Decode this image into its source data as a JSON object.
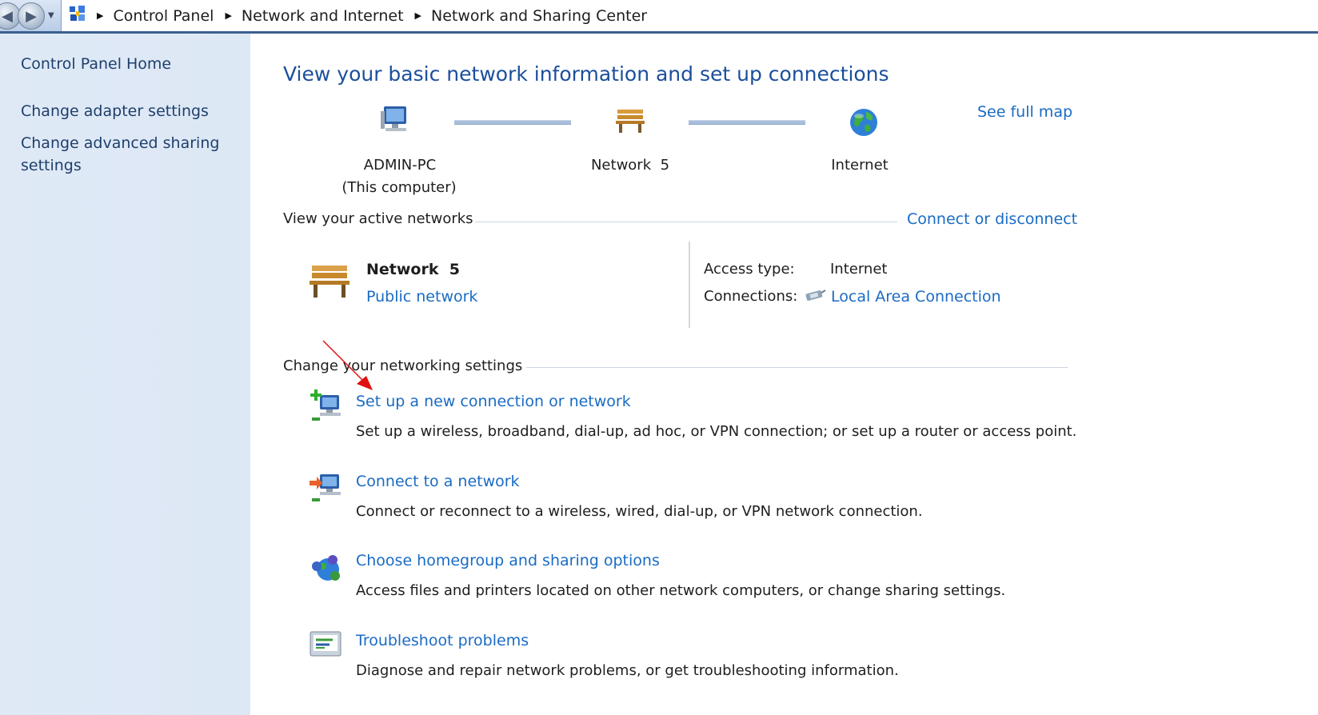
{
  "breadcrumb": {
    "items": [
      "Control Panel",
      "Network and Internet",
      "Network and Sharing Center"
    ]
  },
  "sidebar": {
    "home": "Control Panel Home",
    "links": [
      "Change adapter settings",
      "Change advanced sharing",
      "settings"
    ]
  },
  "main": {
    "title": "View your basic network information and set up connections",
    "see_full_map": "See full map",
    "map": {
      "computer_name": "ADMIN-PC",
      "computer_sub": "(This computer)",
      "network_name": "Network  5",
      "internet": "Internet"
    },
    "active": {
      "heading": "View your active networks",
      "connect_link": "Connect or disconnect",
      "network_name": "Network  5",
      "network_type": "Public network",
      "access_label": "Access type:",
      "access_value": "Internet",
      "connections_label": "Connections:",
      "connections_value": "Local Area Connection"
    },
    "change": {
      "heading": "Change your networking settings",
      "tasks": [
        {
          "title": "Set up a new connection or network",
          "desc": "Set up a wireless, broadband, dial-up, ad hoc, or VPN connection; or set up a router or access point."
        },
        {
          "title": "Connect to a network",
          "desc": "Connect or reconnect to a wireless, wired, dial-up, or VPN network connection."
        },
        {
          "title": "Choose homegroup and sharing options",
          "desc": "Access files and printers located on other network computers, or change sharing settings."
        },
        {
          "title": "Troubleshoot problems",
          "desc": "Diagnose and repair network problems, or get troubleshooting information."
        }
      ]
    }
  },
  "colors": {
    "link": "#1a6bc4",
    "title": "#1b4f9c",
    "sidebar_bg": "#dde8f5",
    "arrow": "#e01010"
  },
  "icons": [
    "back-icon",
    "forward-icon",
    "control-panel-icon",
    "computer-icon",
    "bench-icon",
    "globe-icon",
    "network-adapter-icon",
    "new-connection-icon",
    "connect-network-icon",
    "homegroup-icon",
    "troubleshoot-icon",
    "red-arrow-annotation"
  ]
}
